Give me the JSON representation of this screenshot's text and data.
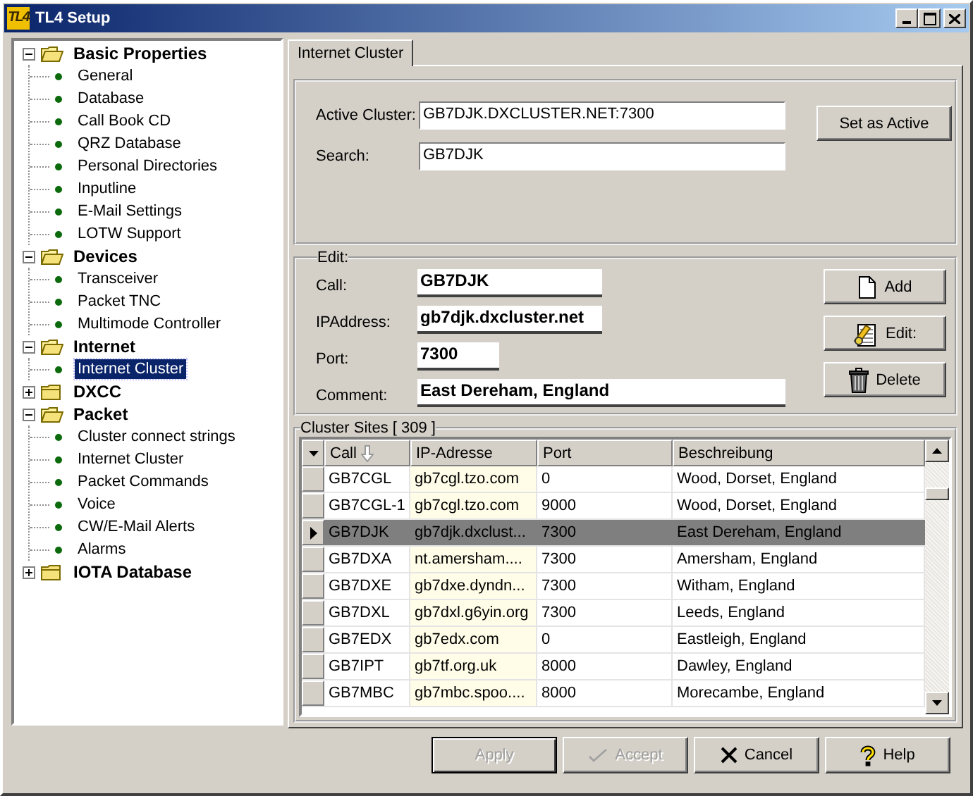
{
  "window": {
    "title": "TL4 Setup",
    "app_icon": "TL4"
  },
  "tree": [
    {
      "label": "Basic Properties",
      "expanded": true,
      "selected": false,
      "children": [
        {
          "label": "General",
          "selected": false
        },
        {
          "label": "Database",
          "selected": false
        },
        {
          "label": "Call Book CD",
          "selected": false
        },
        {
          "label": "QRZ Database",
          "selected": false
        },
        {
          "label": "Personal Directories",
          "selected": false
        },
        {
          "label": "Inputline",
          "selected": false
        },
        {
          "label": "E-Mail Settings",
          "selected": false
        },
        {
          "label": "LOTW Support",
          "selected": false
        }
      ]
    },
    {
      "label": "Devices",
      "expanded": true,
      "selected": false,
      "children": [
        {
          "label": "Transceiver",
          "selected": false
        },
        {
          "label": "Packet TNC",
          "selected": false
        },
        {
          "label": "Multimode Controller",
          "selected": false
        }
      ]
    },
    {
      "label": "Internet",
      "expanded": true,
      "selected": false,
      "children": [
        {
          "label": "Internet Cluster",
          "selected": true
        }
      ]
    },
    {
      "label": "DXCC",
      "expanded": false,
      "selected": false
    },
    {
      "label": "Packet",
      "expanded": true,
      "selected": false,
      "children": [
        {
          "label": "Cluster connect strings",
          "selected": false
        },
        {
          "label": "Internet Cluster",
          "selected": false
        },
        {
          "label": "Packet Commands",
          "selected": false
        },
        {
          "label": "Voice",
          "selected": false
        },
        {
          "label": "CW/E-Mail Alerts",
          "selected": false
        },
        {
          "label": "Alarms",
          "selected": false
        }
      ]
    },
    {
      "label": "IOTA Database",
      "expanded": false,
      "selected": false
    }
  ],
  "tabs": [
    {
      "label": "Internet Cluster",
      "selected": true
    }
  ],
  "cluster": {
    "active_label": "Active Cluster:",
    "active_value": "GB7DJK.DXCLUSTER.NET:7300",
    "search_label": "Search:",
    "search_value": "GB7DJK",
    "set_active_button": "Set as Active"
  },
  "edit": {
    "legend": "Edit:",
    "fields": [
      {
        "label": "Call:",
        "value": "GB7DJK"
      },
      {
        "label": "IPAddress:",
        "value": "gb7djk.dxcluster.net"
      },
      {
        "label": "Port:",
        "value": "7300"
      },
      {
        "label": "Comment:",
        "value": "East Dereham, England"
      }
    ],
    "buttons": [
      "Add",
      "Edit:",
      "Delete"
    ]
  },
  "sites": {
    "legend": "Cluster Sites [ 309 ]",
    "columns": [
      {
        "label": "Call",
        "sorted": true
      },
      {
        "label": "IP-Adresse",
        "sorted": false
      },
      {
        "label": "Port",
        "sorted": false
      },
      {
        "label": "Beschreibung",
        "sorted": false
      }
    ],
    "rows": [
      {
        "cells": [
          "GB7CGL",
          "gb7cgl.tzo.com",
          "0",
          "Wood, Dorset, England"
        ],
        "selected": false
      },
      {
        "cells": [
          "GB7CGL-1",
          "gb7cgl.tzo.com",
          "9000",
          "Wood, Dorset, England"
        ],
        "selected": false
      },
      {
        "cells": [
          "GB7DJK",
          "gb7djk.dxclust...",
          "7300",
          "East Dereham, England"
        ],
        "selected": true
      },
      {
        "cells": [
          "GB7DXA",
          "nt.amersham....",
          "7300",
          "Amersham, England"
        ],
        "selected": false
      },
      {
        "cells": [
          "GB7DXE",
          "gb7dxe.dyndn...",
          "7300",
          "Witham, England"
        ],
        "selected": false
      },
      {
        "cells": [
          "GB7DXL",
          "gb7dxl.g6yin.org",
          "7300",
          "Leeds, England"
        ],
        "selected": false
      },
      {
        "cells": [
          "GB7EDX",
          "gb7edx.com",
          "0",
          "Eastleigh, England"
        ],
        "selected": false
      },
      {
        "cells": [
          "GB7IPT",
          "gb7tf.org.uk",
          "8000",
          "Dawley, England"
        ],
        "selected": false
      },
      {
        "cells": [
          "GB7MBC",
          "gb7mbc.spoo....",
          "8000",
          "Morecambe, England"
        ],
        "selected": false
      }
    ]
  },
  "footer_buttons": [
    {
      "label": "Apply",
      "disabled": true,
      "default": true
    },
    {
      "label": "Accept",
      "disabled": true,
      "default": false
    },
    {
      "label": "Cancel",
      "disabled": false,
      "default": false
    },
    {
      "label": "Help",
      "disabled": false,
      "default": false
    }
  ]
}
